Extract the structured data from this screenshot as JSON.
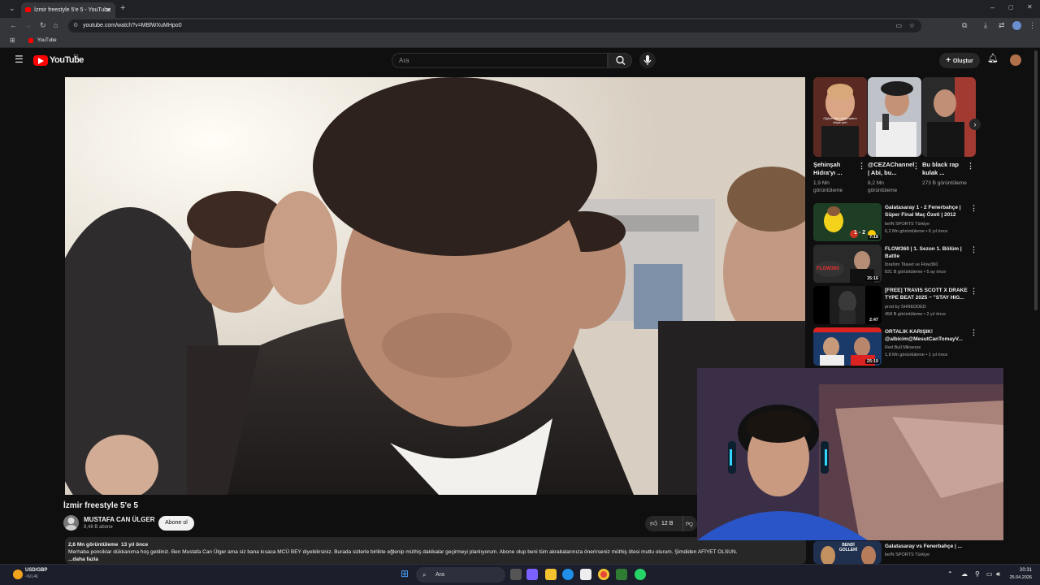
{
  "browser": {
    "tab_title": "İzmir freestyle 5'e 5 - YouTube",
    "url": "youtube.com/watch?v=MBlWXuMHpo0",
    "bookmark": "YouTube"
  },
  "header": {
    "logo": "YouTube",
    "logo_region": "TR",
    "search_placeholder": "Ara",
    "create_label": "Oluştur"
  },
  "video": {
    "title": "İzmir freestyle 5'e 5",
    "channel": "MUSTAFA CAN ÜLGER",
    "subscribers": "8,48 B abone",
    "subscribe_label": "Abone ol",
    "likes": "12 B",
    "views": "2,6 Mn görüntüleme",
    "age": "13 yıl önce",
    "description": "Merhaba ponciklar dükkanıma hoş geldiniz. Ben Mustafa Can Ülger ama siz bana kısaca MCÜ BEY diyebilirsiniz. Burada sizlerle birlikte eğlenip müthiş dakikalar geçirmeyi planlıyorum. Abone olup beni tüm akrabalarınıza önerirseniz müthiş ötesi mutlu olurum. Şimdiden AFİYET OLSUN.",
    "more": "...daha fazla"
  },
  "shorts": [
    {
      "title": "Şehinşah Hidra'yı ...",
      "views": "1,9 Mn görüntüleme",
      "thumb_overlay": "Oğlum Ben Anlamadım böyle yeri"
    },
    {
      "title": "@CEZAChannel | Abi, bu...",
      "views": "8,2 Mn görüntüleme"
    },
    {
      "title": "Bu black rap kulak ...",
      "views": "273 B görüntüleme"
    }
  ],
  "recommendations": [
    {
      "title": "Galatasaray 1 - 2 Fenerbahçe | Süper Final Maç Özeti | 2012",
      "channel": "beIN SPORTS Türkiye",
      "meta": "6,2 Mn görüntüleme • 6 yıl önce",
      "duration": "7:18",
      "thumb_text": "1 - 2"
    },
    {
      "title": "FLOW360 | 1. Sezon 1. Bölüm | Battle",
      "channel": "İbrahim Tilavet ve Flow360",
      "meta": "831 B görüntüleme • 5 ay önce",
      "duration": "35:16",
      "thumb_text": "FLOW360"
    },
    {
      "title": "[FREE] TRAVIS SCOTT X DRAKE TYPE BEAT 2025 ~ \"STAY HIG...",
      "channel": "prod by SHREDDED",
      "meta": "458 B görüntüleme • 2 yıl önce",
      "duration": "2:47"
    },
    {
      "title": "ORTALIK KARIŞIK! @albicim@MesutCanTomayV...",
      "channel": "Red Bull Mikserye",
      "meta": "1,8 Mn görüntüleme • 1 yıl önce",
      "duration": "25:19"
    },
    {
      "title": "Galatasaray vs Fenerbahçe | ...",
      "channel": "beIN SPORTS Türkiye",
      "meta": "",
      "duration": "",
      "thumb_text": "BENDİ GOLLERİ"
    }
  ],
  "taskbar": {
    "ticker": "USD/GBP",
    "ticker_change": "-%0,46",
    "search": "Ara",
    "time": "20:31",
    "date": "25.04.2026"
  },
  "colors": {
    "background": "#0f0f0f",
    "youtube_red": "#ff0000",
    "chrome_dark": "#202124"
  }
}
